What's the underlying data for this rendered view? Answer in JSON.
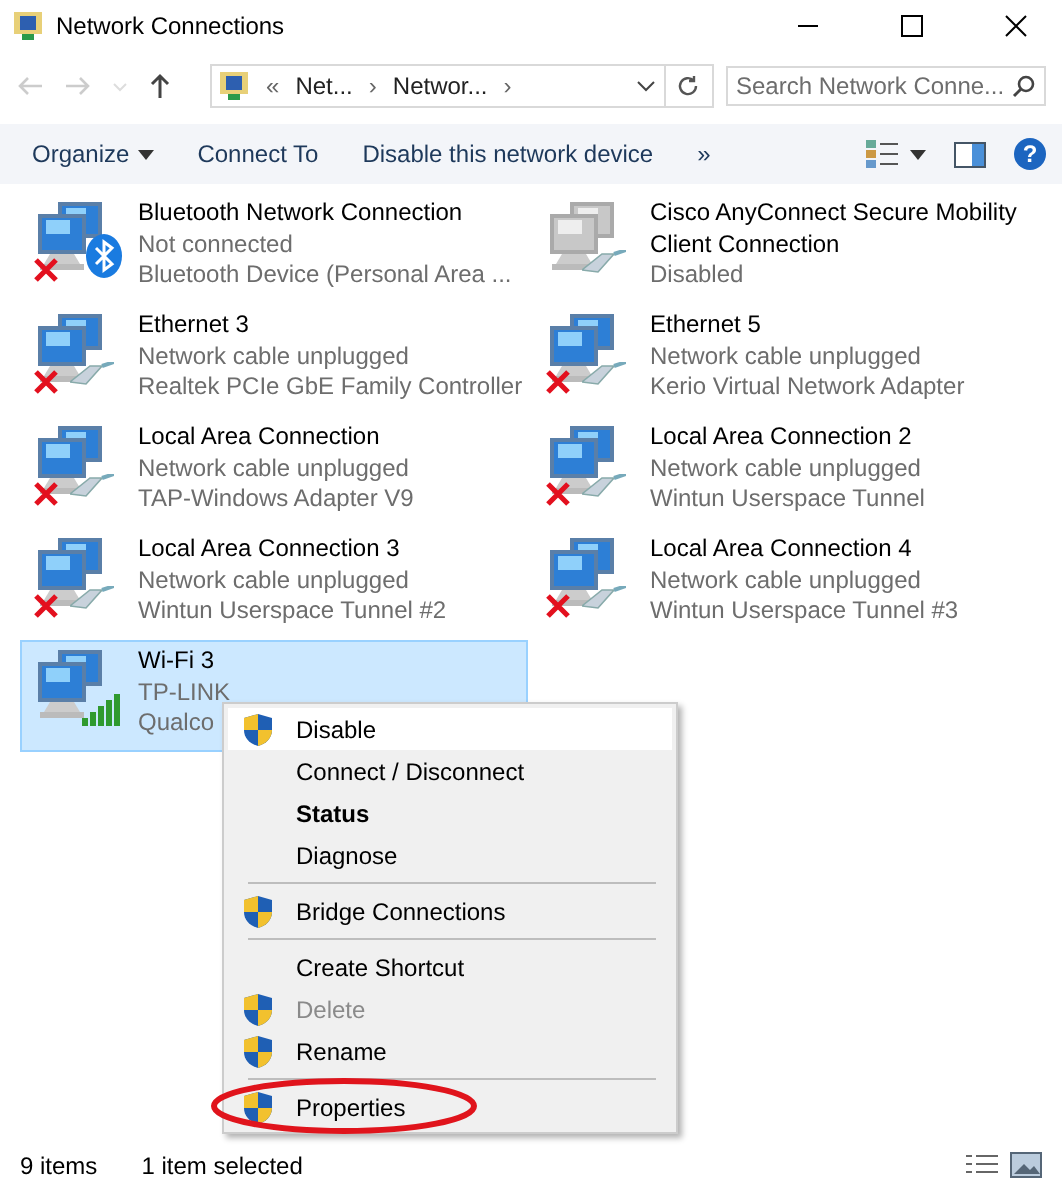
{
  "window": {
    "title": "Network Connections"
  },
  "address_bar": {
    "overflow": "«",
    "crumbs": [
      "Net...",
      "Networ..."
    ],
    "separator": "›"
  },
  "search": {
    "placeholder": "Search Network Conne..."
  },
  "command_bar": {
    "buttons": [
      {
        "label": "Organize",
        "dropdown": true
      },
      {
        "label": "Connect To",
        "dropdown": false
      },
      {
        "label": "Disable this network device",
        "dropdown": false
      }
    ],
    "more": "»",
    "help": "?"
  },
  "connections": [
    {
      "name": "Bluetooth Network Connection",
      "lines": [
        "Not connected",
        "Bluetooth Device (Personal Area ..."
      ],
      "kind": "bluetooth",
      "error": true,
      "disabled": false,
      "selected": false
    },
    {
      "name": "Cisco AnyConnect Secure Mobility Client Connection",
      "lines": [
        "Disabled"
      ],
      "kind": "cable",
      "error": false,
      "disabled": true,
      "selected": false
    },
    {
      "name": "Ethernet 3",
      "lines": [
        "Network cable unplugged",
        "Realtek PCIe GbE Family Controller"
      ],
      "kind": "cable",
      "error": true,
      "disabled": false,
      "selected": false
    },
    {
      "name": "Ethernet 5",
      "lines": [
        "Network cable unplugged",
        "Kerio Virtual Network Adapter"
      ],
      "kind": "cable",
      "error": true,
      "disabled": false,
      "selected": false
    },
    {
      "name": "Local Area Connection",
      "lines": [
        "Network cable unplugged",
        "TAP-Windows Adapter V9"
      ],
      "kind": "cable",
      "error": true,
      "disabled": false,
      "selected": false
    },
    {
      "name": "Local Area Connection 2",
      "lines": [
        "Network cable unplugged",
        "Wintun Userspace Tunnel"
      ],
      "kind": "cable",
      "error": true,
      "disabled": false,
      "selected": false
    },
    {
      "name": "Local Area Connection 3",
      "lines": [
        "Network cable unplugged",
        "Wintun Userspace Tunnel #2"
      ],
      "kind": "cable",
      "error": true,
      "disabled": false,
      "selected": false
    },
    {
      "name": "Local Area Connection 4",
      "lines": [
        "Network cable unplugged",
        "Wintun Userspace Tunnel #3"
      ],
      "kind": "cable",
      "error": true,
      "disabled": false,
      "selected": false
    },
    {
      "name": "Wi-Fi 3",
      "lines": [
        "TP-LINK",
        "Qualco"
      ],
      "kind": "wifi",
      "error": false,
      "disabled": false,
      "selected": true
    }
  ],
  "context_menu": [
    {
      "kind": "item",
      "label": "Disable",
      "shield": true,
      "bold": false,
      "disabled": false,
      "selected": true,
      "circled": false
    },
    {
      "kind": "item",
      "label": "Connect / Disconnect",
      "shield": false,
      "bold": false,
      "disabled": false,
      "selected": false,
      "circled": false
    },
    {
      "kind": "item",
      "label": "Status",
      "shield": false,
      "bold": true,
      "disabled": false,
      "selected": false,
      "circled": false
    },
    {
      "kind": "item",
      "label": "Diagnose",
      "shield": false,
      "bold": false,
      "disabled": false,
      "selected": false,
      "circled": false
    },
    {
      "kind": "separator"
    },
    {
      "kind": "item",
      "label": "Bridge Connections",
      "shield": true,
      "bold": false,
      "disabled": false,
      "selected": false,
      "circled": false
    },
    {
      "kind": "separator"
    },
    {
      "kind": "item",
      "label": "Create Shortcut",
      "shield": false,
      "bold": false,
      "disabled": false,
      "selected": false,
      "circled": false
    },
    {
      "kind": "item",
      "label": "Delete",
      "shield": true,
      "bold": false,
      "disabled": true,
      "selected": false,
      "circled": false
    },
    {
      "kind": "item",
      "label": "Rename",
      "shield": true,
      "bold": false,
      "disabled": false,
      "selected": false,
      "circled": false
    },
    {
      "kind": "separator"
    },
    {
      "kind": "item",
      "label": "Properties",
      "shield": true,
      "bold": false,
      "disabled": false,
      "selected": false,
      "circled": true
    }
  ],
  "status_bar": {
    "count": "9 items",
    "selection": "1 item selected"
  }
}
